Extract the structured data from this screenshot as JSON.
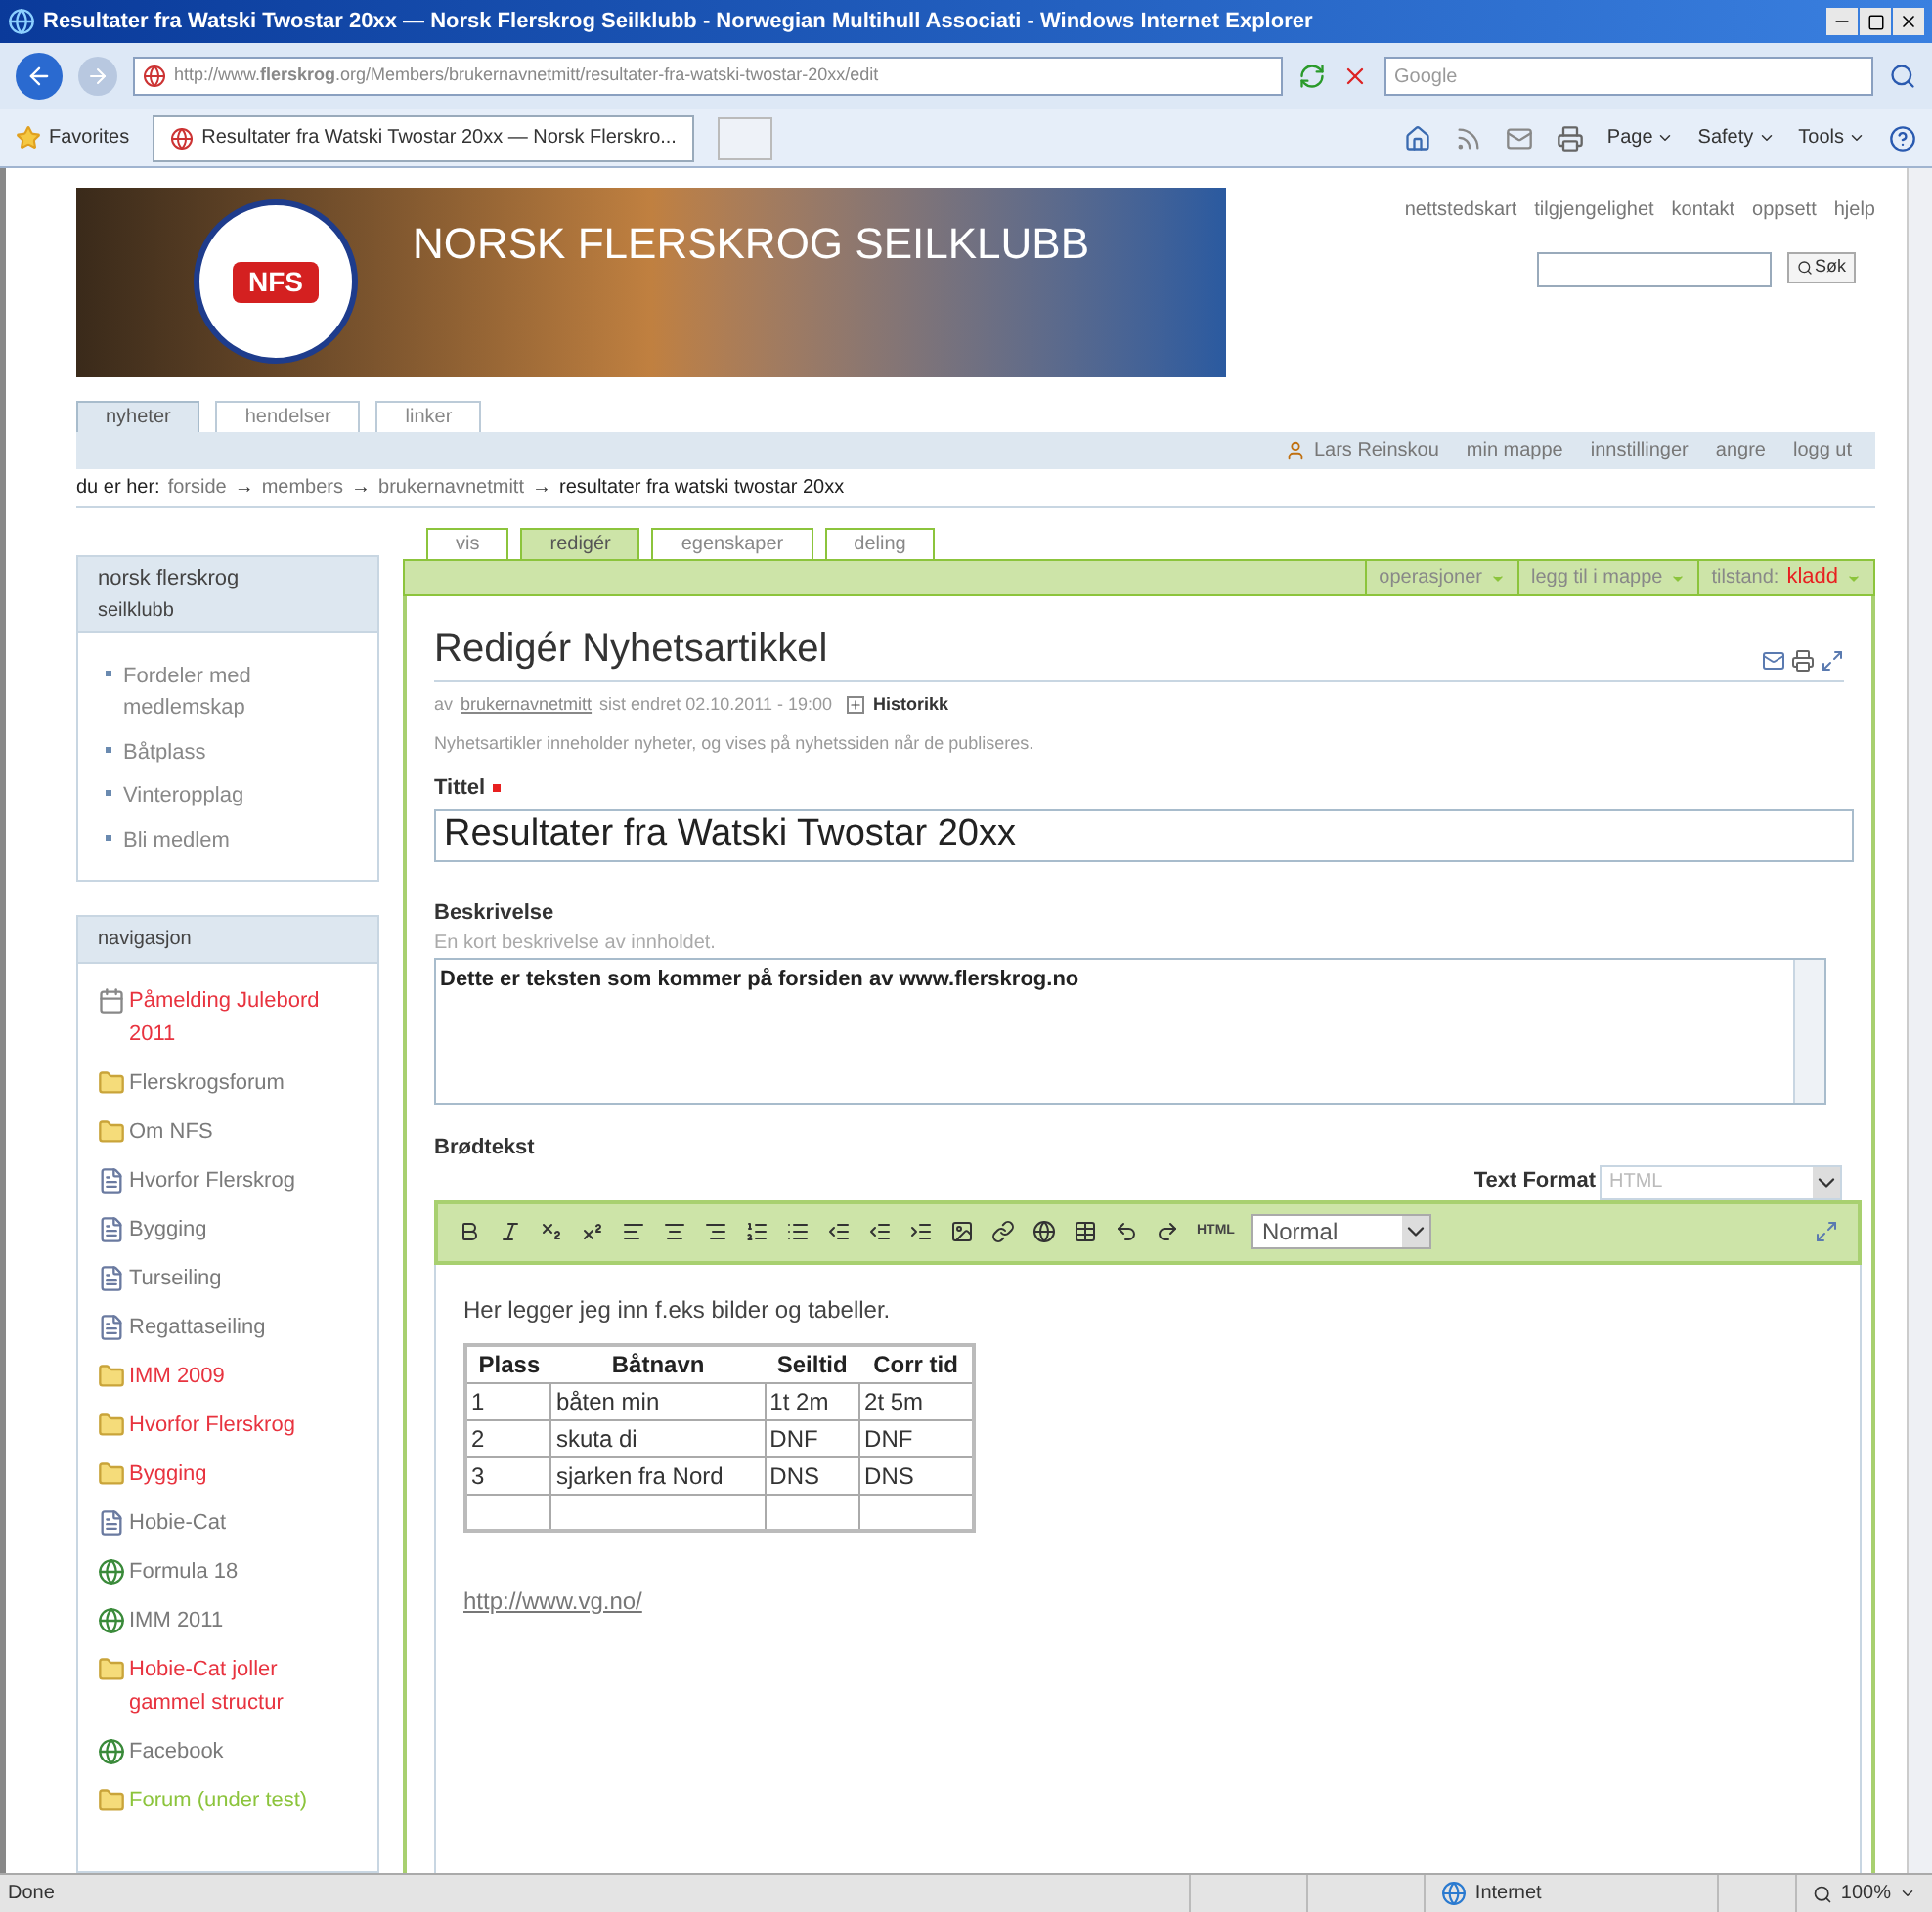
{
  "browser": {
    "title": "Resultater fra Watski Twostar 20xx — Norsk Flerskrog Seilklubb - Norwegian Multihull Associati - Windows Internet Explorer",
    "address": "http://www.**flerskrog**.org/Members/brukernavnetmitt/resultater-fra-watski-twostar-20xx/edit",
    "search_placeholder": "Google",
    "favorites": "Favorites",
    "tab": "Resultater fra Watski Twostar 20xx — Norsk Flerskro...",
    "commands": [
      "Page",
      "Safety",
      "Tools"
    ],
    "status": "Done",
    "zone": "Internet",
    "zoom": "100%"
  },
  "site": {
    "logo": "NFS",
    "title": "NORSK FLERSKROG SEILKLUBB",
    "links": [
      "nettstedskart",
      "tilgjengelighet",
      "kontakt",
      "oppsett",
      "hjelp"
    ],
    "search_button": "Søk",
    "sections": [
      {
        "label": "nyheter",
        "selected": true
      },
      {
        "label": "hendelser",
        "selected": false
      },
      {
        "label": "linker",
        "selected": false
      }
    ],
    "user": "Lars Reinskou",
    "personal": [
      "min mappe",
      "innstillinger",
      "angre",
      "logg ut"
    ],
    "breadcrumb_label": "du er her:",
    "breadcrumb_separator": "→",
    "breadcrumb": [
      {
        "label": "forside",
        "kind": "link"
      },
      {
        "label": "members",
        "kind": "link"
      },
      {
        "label": "brukernavnetmitt",
        "kind": "link"
      },
      {
        "label": "resultater fra watski twostar 20xx",
        "kind": "current"
      }
    ]
  },
  "sidebar": {
    "box": {
      "title": "norsk flerskrog",
      "subtitle": "seilklubb",
      "items": [
        "Fordeler med medlemskap",
        "Båtplass",
        "Vinteropplag",
        "Bli medlem"
      ]
    },
    "navigation": {
      "title": "navigasjon",
      "items": [
        {
          "label": "Påmelding Julebord 2011",
          "kind": "event",
          "color": "#e8333f"
        },
        {
          "label": "Flerskrogsforum",
          "kind": "folder",
          "color": "#7a7a7a"
        },
        {
          "label": "Om NFS",
          "kind": "folder",
          "color": "#7a7a7a"
        },
        {
          "label": "Hvorfor Flerskrog",
          "kind": "page",
          "color": "#7a7a7a"
        },
        {
          "label": "Bygging",
          "kind": "page",
          "color": "#7a7a7a"
        },
        {
          "label": "Turseiling",
          "kind": "page",
          "color": "#7a7a7a"
        },
        {
          "label": "Regattaseiling",
          "kind": "page",
          "color": "#7a7a7a"
        },
        {
          "label": "IMM 2009",
          "kind": "folder",
          "color": "#e8333f"
        },
        {
          "label": "Hvorfor Flerskrog",
          "kind": "folder",
          "color": "#e8333f"
        },
        {
          "label": "Bygging",
          "kind": "folder",
          "color": "#e8333f"
        },
        {
          "label": "Hobie-Cat",
          "kind": "page",
          "color": "#7a7a7a"
        },
        {
          "label": "Formula 18",
          "kind": "globe",
          "color": "#7a7a7a"
        },
        {
          "label": "IMM 2011",
          "kind": "globe",
          "color": "#7a7a7a"
        },
        {
          "label": "Hobie-Cat joller gammel structur",
          "kind": "folder",
          "color": "#e8333f"
        },
        {
          "label": "Facebook",
          "kind": "globe",
          "color": "#7a7a7a"
        },
        {
          "label": "Forum (under test)",
          "kind": "folder",
          "color": "#8cc43c"
        }
      ]
    }
  },
  "content": {
    "tabs": [
      {
        "label": "vis",
        "selected": false
      },
      {
        "label": "redigér",
        "selected": true
      },
      {
        "label": "egenskaper",
        "selected": false
      },
      {
        "label": "deling",
        "selected": false
      }
    ],
    "menus": [
      "operasjoner",
      "legg til i mappe"
    ],
    "state_label": "tilstand:",
    "state": "kladd",
    "heading": "Redigér Nyhetsartikkel",
    "byline": {
      "prefix": "av",
      "author": "brukernavnetmitt",
      "modified": "sist endret 02.10.2011 - 19:00",
      "history": "Historikk"
    },
    "description": "Nyhetsartikler inneholder nyheter, og vises på nyhetssiden når de publiseres.",
    "title_field": {
      "label": "Tittel",
      "required": true,
      "value": "Resultater fra Watski Twostar 20xx"
    },
    "summary_field": {
      "label": "Beskrivelse",
      "help": "En kort beskrivelse av innholdet.",
      "value": "Dette er teksten som kommer på forsiden av www.flerskrog.no"
    },
    "body_field": {
      "label": "Brødtekst",
      "format_label": "Text Format",
      "format": "HTML",
      "html_button": "HTML",
      "style": "Normal",
      "intro": "Her legger jeg inn f.eks bilder og tabeller.",
      "table": {
        "columns": [
          "Plass",
          "Båtnavn",
          "Seiltid",
          "Corr tid"
        ],
        "rows": [
          [
            "1",
            "båten min",
            "1t 2m",
            "2t 5m"
          ],
          [
            "2",
            "skuta di",
            "DNF",
            "DNF"
          ],
          [
            "3",
            "sjarken fra Nord",
            "DNS",
            "DNS"
          ]
        ]
      },
      "link": "http://www.vg.no/"
    }
  }
}
